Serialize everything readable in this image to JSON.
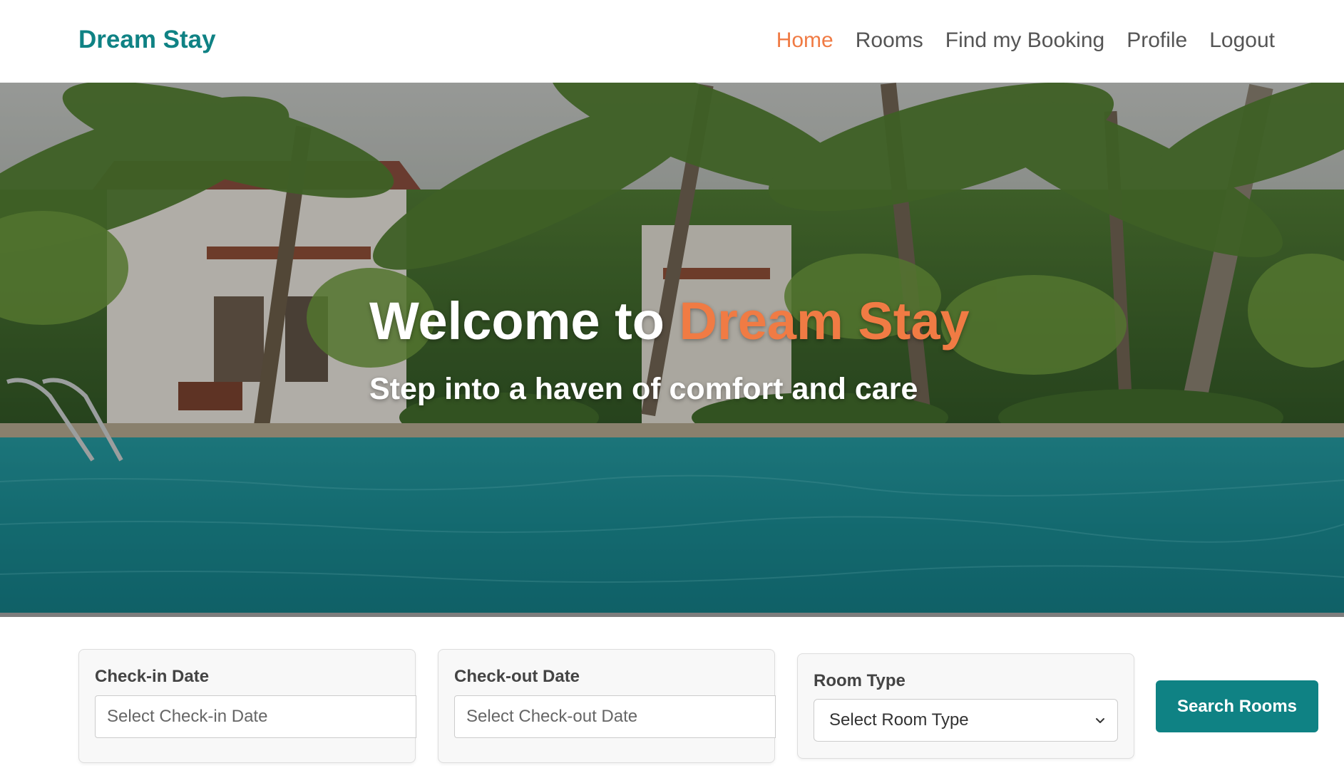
{
  "brand": {
    "name": "Dream Stay"
  },
  "nav": {
    "items": [
      {
        "label": "Home",
        "active": true
      },
      {
        "label": "Rooms",
        "active": false
      },
      {
        "label": "Find my Booking",
        "active": false
      },
      {
        "label": "Profile",
        "active": false
      },
      {
        "label": "Logout",
        "active": false
      }
    ]
  },
  "hero": {
    "title_prefix": "Welcome to ",
    "title_accent": "Dream Stay",
    "subtitle": "Step into a haven of comfort and care"
  },
  "search": {
    "checkin": {
      "label": "Check-in Date",
      "placeholder": "Select Check-in Date"
    },
    "checkout": {
      "label": "Check-out Date",
      "placeholder": "Select Check-out Date"
    },
    "room_type": {
      "label": "Room Type",
      "selected": "Select Room Type"
    },
    "button_label": "Search Rooms"
  },
  "colors": {
    "brand": "#0f8284",
    "accent": "#f07b44",
    "nav_text": "#555555",
    "pool": "#1a8f97"
  }
}
